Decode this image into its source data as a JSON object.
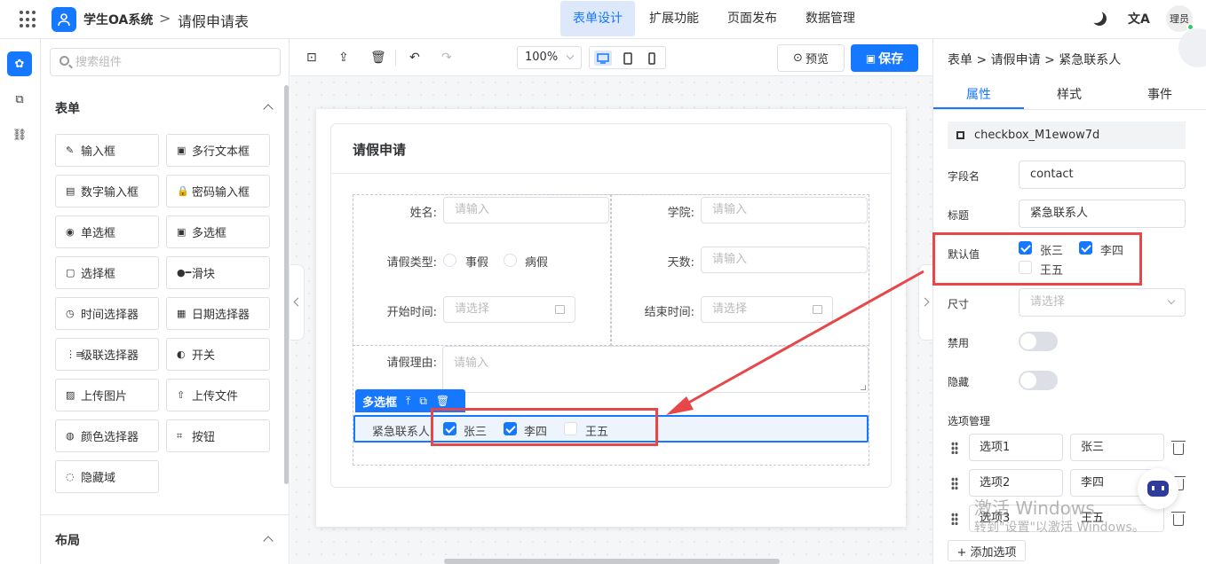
{
  "topbar": {
    "app_name": "学生OA系统",
    "crumb_sep": ">",
    "page_name": "请假申请表",
    "tabs": [
      {
        "label": "表单设计",
        "active": true
      },
      {
        "label": "扩展功能",
        "active": false
      },
      {
        "label": "页面发布",
        "active": false
      },
      {
        "label": "数据管理",
        "active": false
      }
    ],
    "lang_icon": "文A",
    "avatar_text": "理员"
  },
  "components": {
    "search_placeholder": "搜索组件",
    "section_form": "表单",
    "items": [
      {
        "icon": "✎",
        "label": "输入框"
      },
      {
        "icon": "▣",
        "label": "多行文本框"
      },
      {
        "icon": "▤",
        "label": "数字输入框"
      },
      {
        "icon": "🔒",
        "label": "密码输入框"
      },
      {
        "icon": "◉",
        "label": "单选框"
      },
      {
        "icon": "▣",
        "label": "多选框"
      },
      {
        "icon": "▢",
        "label": "选择框"
      },
      {
        "icon": "●━",
        "label": "滑块"
      },
      {
        "icon": "◷",
        "label": "时间选择器"
      },
      {
        "icon": "▦",
        "label": "日期选择器"
      },
      {
        "icon": "⋮≡",
        "label": "级联选择器"
      },
      {
        "icon": "◐",
        "label": "开关"
      },
      {
        "icon": "▨",
        "label": "上传图片"
      },
      {
        "icon": "⇧",
        "label": "上传文件"
      },
      {
        "icon": "◍",
        "label": "颜色选择器"
      },
      {
        "icon": "⌗",
        "label": "按钮"
      },
      {
        "icon": "◌",
        "label": "隐藏域"
      }
    ],
    "section_layout": "布局"
  },
  "toolbar": {
    "zoom": "100%",
    "preview_label": "预览",
    "save_label": "保存"
  },
  "form": {
    "title": "请假申请",
    "name_label": "姓名:",
    "name_placeholder": "请输入",
    "college_label": "学院:",
    "college_placeholder": "请输入",
    "leave_type_label": "请假类型:",
    "leave_type_options": [
      "事假",
      "病假"
    ],
    "days_label": "天数:",
    "days_placeholder": "请输入",
    "start_label": "开始时间:",
    "start_placeholder": "请选择",
    "end_label": "结束时间:",
    "end_placeholder": "请选择",
    "reason_label": "请假理由:",
    "reason_placeholder": "请输入",
    "selected_widget": "多选框",
    "contact_label": "紧急联系人",
    "contact_options": [
      {
        "label": "张三",
        "checked": true
      },
      {
        "label": "李四",
        "checked": true
      },
      {
        "label": "王五",
        "checked": false
      }
    ]
  },
  "props": {
    "breadcrumb": "表单 > 请假申请 > 紧急联系人",
    "tabs": [
      {
        "label": "属性",
        "active": true
      },
      {
        "label": "样式",
        "active": false
      },
      {
        "label": "事件",
        "active": false
      }
    ],
    "widget_id": "checkbox_M1ewow7d",
    "field_label": "字段名",
    "field_value": "contact",
    "title_label": "标题",
    "title_value": "紧急联系人",
    "default_label": "默认值",
    "default_options": [
      {
        "label": "张三",
        "checked": true
      },
      {
        "label": "李四",
        "checked": true
      },
      {
        "label": "王五",
        "checked": false
      }
    ],
    "size_label": "尺寸",
    "size_placeholder": "请选择",
    "disabled_label": "禁用",
    "hidden_label": "隐藏",
    "options_label": "选项管理",
    "options": [
      {
        "key": "选项1",
        "value": "张三"
      },
      {
        "key": "选项2",
        "value": "李四"
      },
      {
        "key": "选项3",
        "value": "王五"
      }
    ],
    "add_option": "+ 添加选项"
  },
  "watermark": {
    "line1": "激活 Windows",
    "line2": "转到\"设置\"以激活 Windows。"
  },
  "colors": {
    "accent": "#1677ff",
    "annotation": "#e8474a"
  }
}
